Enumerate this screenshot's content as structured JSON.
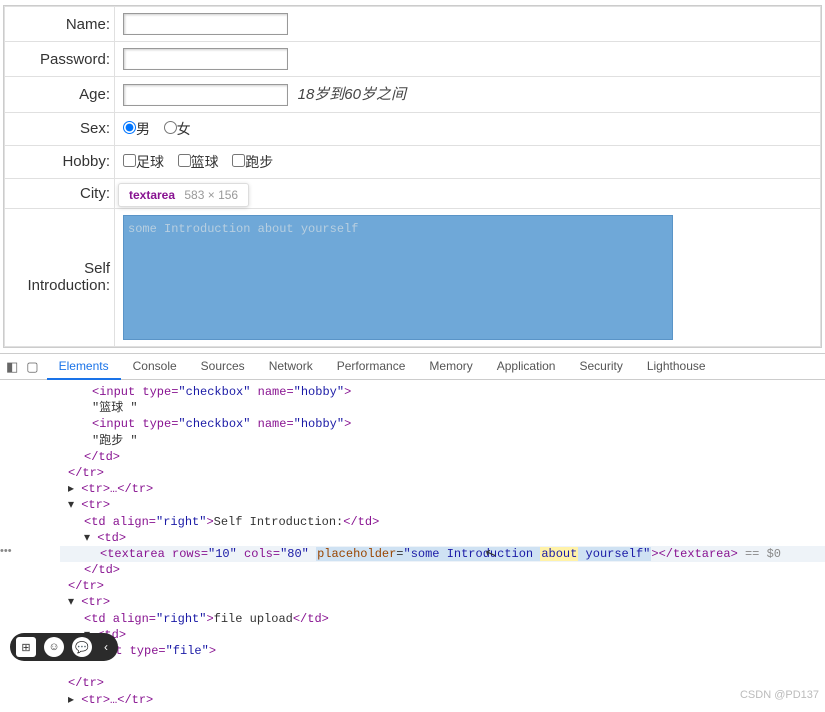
{
  "form": {
    "labels": {
      "name": "Name:",
      "password": "Password:",
      "age": "Age:",
      "sex": "Sex:",
      "hobby": "Hobby:",
      "city": "City:",
      "self_intro": "Self Introduction:"
    },
    "age_note": "18岁到60岁之间",
    "sex_options": {
      "male": "男",
      "female": "女"
    },
    "hobbies": {
      "football": "足球",
      "basketball": "篮球",
      "running": "跑步"
    },
    "textarea_placeholder": "some Introduction about yourself"
  },
  "tooltip": {
    "tag": "textarea",
    "dims": "583 × 156"
  },
  "devtools": {
    "tabs": [
      "Elements",
      "Console",
      "Sources",
      "Network",
      "Performance",
      "Memory",
      "Application",
      "Security",
      "Lighthouse"
    ],
    "active_tab": "Elements"
  },
  "code": {
    "l1_open": "<input type=",
    "l1_v1": "\"checkbox\"",
    "l1_mid": " name=",
    "l1_v2": "\"hobby\"",
    "l1_close": ">",
    "l2": "\"篮球 \"",
    "l3_open": "<input type=",
    "l3_close": ">",
    "l4": "\"跑步 \"",
    "l5": "</td>",
    "l6": "</tr>",
    "l7": "<tr>…</tr>",
    "l8": "<tr>",
    "l9a": "<td align=",
    "l9v": "\"right\"",
    "l9b": ">",
    "l9t": "Self Introduction:",
    "l9c": "</td>",
    "l10": "<td>",
    "l11a": "<textarea rows=",
    "l11v1": "\"10\"",
    "l11b": " cols=",
    "l11v2": "\"80\"",
    "l11c": " ",
    "l11p": "placeholder",
    "l11eq": "=",
    "l11pv": "\"some Introduction about yourself\"",
    "l11d": ">",
    "l11e": "</textarea>",
    "l11sel": " == $0",
    "l12": "</td>",
    "l13": "</tr>",
    "l14": "<tr>",
    "l15a": "<td align=",
    "l15v": "\"right\"",
    "l15b": ">",
    "l15t": "file upload",
    "l15c": "</td>",
    "l16": "<td>",
    "l17a": "ut type=",
    "l17v": "\"file\"",
    "l17b": ">",
    "l19": "</tr>",
    "l20": "<tr>…</tr>"
  },
  "watermark": "CSDN @PD137"
}
